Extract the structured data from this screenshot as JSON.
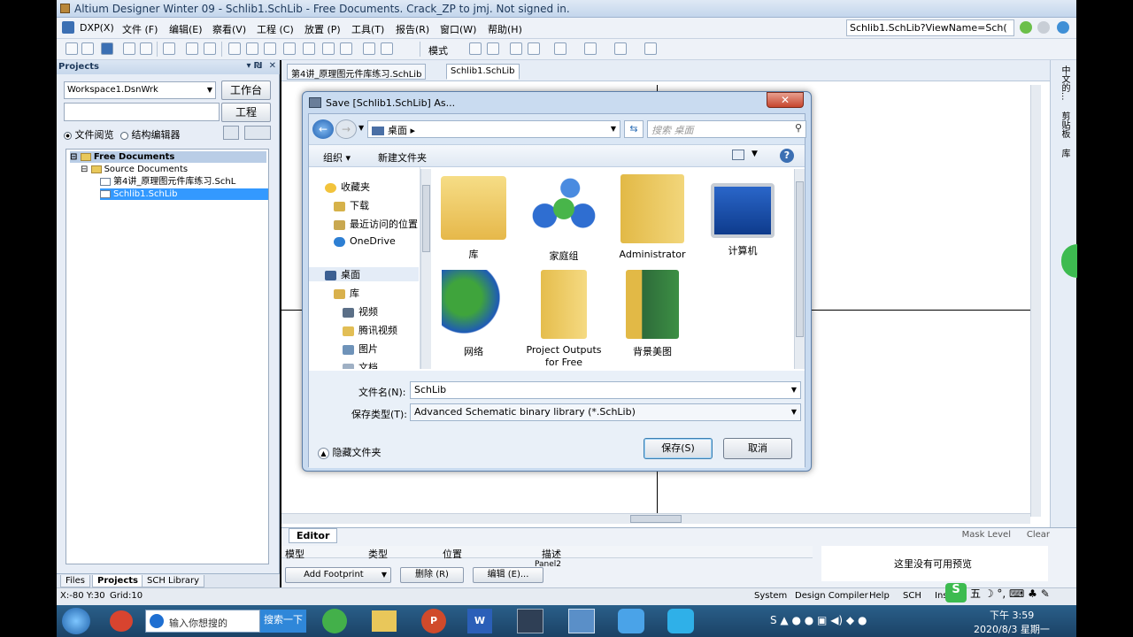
{
  "window": {
    "title": "Altium Designer Winter 09 - Schlib1.SchLib - Free Documents. Crack_ZP to jmj. Not signed in.",
    "address": "Schlib1.SchLib?ViewName=Sch("
  },
  "menu": [
    "DXP(X)",
    "文件 (F)",
    "编辑(E)",
    "察看(V)",
    "工程 (C)",
    "放置 (P)",
    "工具(T)",
    "报告(R)",
    "窗口(W)",
    "帮助(H)"
  ],
  "toolbar": {
    "mode_label": "模式"
  },
  "projects": {
    "title": "Projects",
    "workspace": "Workspace1.DsnWrk",
    "workspace_btn": "工作台",
    "project_btn": "工程",
    "radio_file": "文件阅览",
    "radio_struct": "结构编辑器",
    "tree": {
      "root": "Free Documents",
      "group": "Source Documents",
      "item1": "第4讲_原理图元件库练习.SchL",
      "item2": "Schlib1.SchLib"
    },
    "tabs": [
      "Files",
      "Projects",
      "SCH Library"
    ]
  },
  "doc_tabs": [
    "第4讲_原理图元件库练习.SchLib",
    "Schlib1.SchLib"
  ],
  "right_rail": [
    "中文的...",
    "剪贴板",
    "库"
  ],
  "editor": {
    "tab": "Editor",
    "mask_level": "Mask Level",
    "clear": "Clear",
    "columns": [
      "模型",
      "类型",
      "位置",
      "描述"
    ],
    "panel_label": "Panel2",
    "no_preview": "这里没有可用预览",
    "add_footprint": "Add Footprint",
    "delete": "删除 (R)",
    "edit": "编辑 (E)..."
  },
  "status": {
    "coords": "X:-80 Y:30",
    "grid": "Grid:10",
    "buttons": [
      "System",
      "Design Compiler",
      "Help",
      "SCH",
      "Ins"
    ]
  },
  "taskbar": {
    "search_placeholder": "输入你想搜的",
    "search_btn": "搜索一下",
    "time": "下午 3:59",
    "date": "2020/8/3 星期一"
  },
  "dialog": {
    "title": "Save [Schlib1.SchLib] As...",
    "location": "桌面",
    "search_placeholder": "搜索 桌面",
    "organize": "组织",
    "new_folder": "新建文件夹",
    "nav": {
      "favorites": "收藏夹",
      "downloads": "下载",
      "recent": "最近访问的位置",
      "onedrive": "OneDrive",
      "desktop": "桌面",
      "libraries": "库",
      "videos": "视频",
      "tencent_video": "腾讯视频",
      "pictures": "图片",
      "documents": "文档"
    },
    "items": [
      "库",
      "家庭组",
      "Administrator",
      "计算机",
      "网络",
      "Project Outputs for Free",
      "背景美图"
    ],
    "filename_label": "文件名(N):",
    "filename_value": "SchLib",
    "filetype_label": "保存类型(T):",
    "filetype_value": "Advanced Schematic binary library (*.SchLib)",
    "hide_folders": "隐藏文件夹",
    "save": "保存(S)",
    "cancel": "取消"
  },
  "colors": {
    "accent": "#3399ff",
    "selected": "#3399ff",
    "titlebar": "#dfe9f5",
    "dialog_frame": "#c9dbf0"
  }
}
